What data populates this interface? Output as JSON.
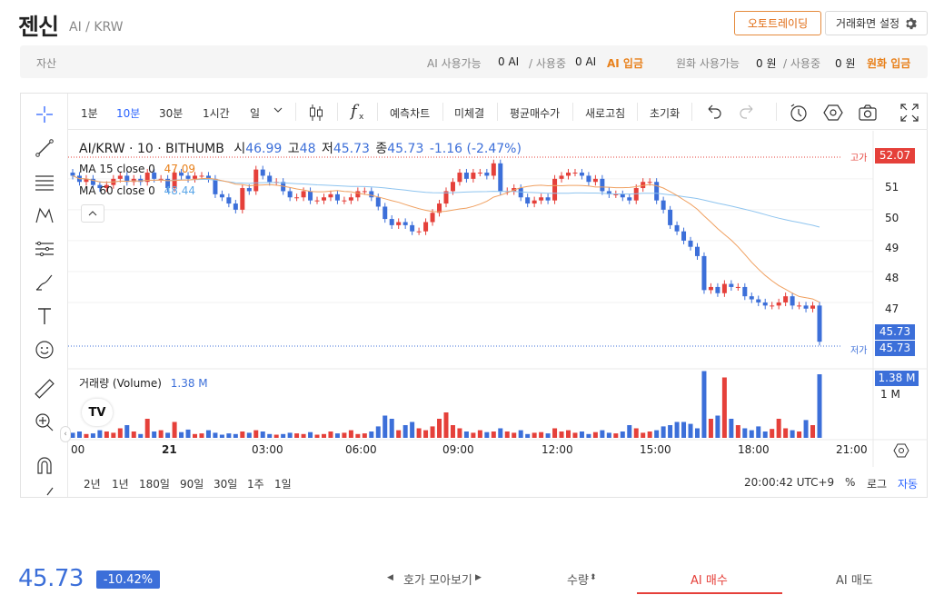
{
  "header": {
    "name": "젠신",
    "pair": "AI / KRW",
    "auto_btn": "오토트레이딩",
    "settings_btn": "거래화면 설정"
  },
  "assets": {
    "label": "자산",
    "coin_available_label": "AI 사용가능",
    "coin_available": "0 AI",
    "coin_sep": "/ 사용중",
    "coin_used": "0 AI",
    "coin_deposit": "AI 입금",
    "krw_available_label": "원화 사용가능",
    "krw_available": "0 원",
    "krw_sep": "/ 사용중",
    "krw_used": "0 원",
    "krw_deposit": "원화 입금"
  },
  "toolbar": {
    "intervals": [
      "1분",
      "10분",
      "30분",
      "1시간",
      "일"
    ],
    "selected_interval": "10분",
    "fx": "f",
    "forecast": "예측차트",
    "unfilled": "미체결",
    "avg_price": "평균매수가",
    "refresh": "새로고침",
    "reset": "초기화"
  },
  "legend": {
    "title": "AI/KRW · 10 · BITHUMB",
    "o_label": "시",
    "o": "46.99",
    "h_label": "고",
    "h": "48",
    "l_label": "저",
    "l": "45.73",
    "c_label": "종",
    "c": "45.73",
    "change": "-1.16 (-2.47%)",
    "ma15_label": "MA 15 close 0",
    "ma15": "47.09",
    "ma60_label": "MA 60 close 0",
    "ma60": "48.44",
    "volume_label": "거래량 (Volume)",
    "volume": "1.38 M"
  },
  "axis": {
    "y_ticks": [
      "51",
      "50",
      "49",
      "48",
      "47"
    ],
    "high_label": "고가",
    "high_value": "52.07",
    "low_label": "저가",
    "last_value": "45.73",
    "low_value": "45.73",
    "vol_badge": "1.38 M",
    "vol_tick": "1 M",
    "x_ticks": [
      "00",
      "21",
      "03:00",
      "06:00",
      "09:00",
      "12:00",
      "15:00",
      "18:00",
      "21:00"
    ]
  },
  "ranges": [
    "2년",
    "1년",
    "180일",
    "90일",
    "30일",
    "1주",
    "1일"
  ],
  "timestamp": "20:00:42 UTC+9",
  "scale_opts": {
    "pct": "%",
    "log": "로그",
    "auto": "자동"
  },
  "colors": {
    "up": "#e5403a",
    "down": "#3c6fd9",
    "accent": "#e8801a",
    "ma15": "#f0a060",
    "ma60": "#8ec4ef"
  },
  "footer": {
    "price": "45.73",
    "change": "-10.42%",
    "orderbook": "호가 모아보기",
    "qty": "수량",
    "buy": "AI 매수",
    "sell": "AI 매도"
  },
  "chart_data": {
    "type": "candlestick",
    "ylim": [
      45.5,
      52.2
    ],
    "closes": [
      51.1,
      50.9,
      51.0,
      50.8,
      50.7,
      50.8,
      51.0,
      51.1,
      50.9,
      51.0,
      50.9,
      51.2,
      51.0,
      51.0,
      50.7,
      51.2,
      51.1,
      51.0,
      51.1,
      51.1,
      51.0,
      50.5,
      50.4,
      50.2,
      50.0,
      50.7,
      50.6,
      51.3,
      51.1,
      50.9,
      50.9,
      50.6,
      50.4,
      50.4,
      50.6,
      50.3,
      50.3,
      50.4,
      50.5,
      50.3,
      50.3,
      50.4,
      50.6,
      50.6,
      50.4,
      50.1,
      49.7,
      49.5,
      49.6,
      49.5,
      49.3,
      49.3,
      49.6,
      49.9,
      50.2,
      50.6,
      50.9,
      51.2,
      51.0,
      51.2,
      51.2,
      51.1,
      51.5,
      50.6,
      50.6,
      50.7,
      50.4,
      50.2,
      50.3,
      50.4,
      50.3,
      51.0,
      51.1,
      51.2,
      51.2,
      51.1,
      50.9,
      51.0,
      50.6,
      50.5,
      50.5,
      50.4,
      50.3,
      50.7,
      50.9,
      50.9,
      50.3,
      50.0,
      49.5,
      49.3,
      49.0,
      48.8,
      48.5,
      47.4,
      47.5,
      47.3,
      47.6,
      47.5,
      47.5,
      47.2,
      47.1,
      47.0,
      46.9,
      46.9,
      47.0,
      47.2,
      46.9,
      46.9,
      46.8,
      46.9,
      45.73
    ],
    "volumes": [
      0.08,
      0.1,
      0.06,
      0.07,
      0.12,
      0.1,
      0.08,
      0.15,
      0.2,
      0.1,
      0.06,
      0.3,
      0.1,
      0.12,
      0.08,
      0.25,
      0.09,
      0.13,
      0.06,
      0.07,
      0.12,
      0.08,
      0.05,
      0.07,
      0.06,
      0.1,
      0.08,
      0.12,
      0.1,
      0.06,
      0.05,
      0.06,
      0.08,
      0.07,
      0.06,
      0.09,
      0.05,
      0.06,
      0.1,
      0.07,
      0.08,
      0.12,
      0.06,
      0.07,
      0.1,
      0.18,
      0.35,
      0.3,
      0.12,
      0.2,
      0.25,
      0.15,
      0.12,
      0.18,
      0.3,
      0.4,
      0.2,
      0.15,
      0.1,
      0.08,
      0.12,
      0.09,
      0.1,
      0.15,
      0.1,
      0.08,
      0.12,
      0.06,
      0.08,
      0.09,
      0.07,
      0.15,
      0.1,
      0.12,
      0.08,
      0.1,
      0.06,
      0.09,
      0.12,
      0.08,
      0.07,
      0.1,
      0.2,
      0.15,
      0.08,
      0.1,
      0.12,
      0.18,
      0.2,
      0.25,
      0.25,
      0.22,
      0.15,
      1.05,
      0.3,
      0.35,
      0.95,
      0.3,
      0.2,
      0.15,
      0.12,
      0.18,
      0.1,
      0.14,
      0.3,
      0.15,
      0.12,
      0.1,
      0.28,
      0.2,
      1.0
    ]
  }
}
